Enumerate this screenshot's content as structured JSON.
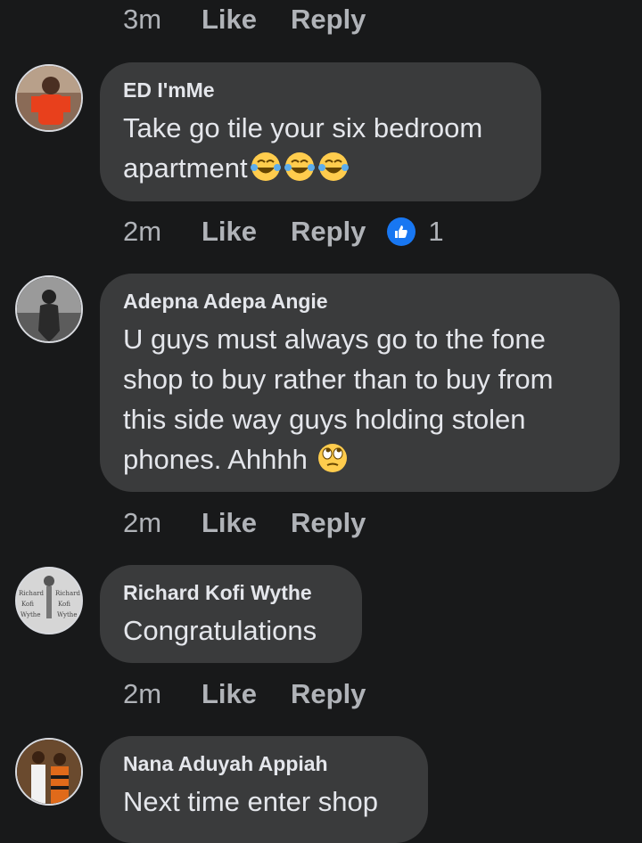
{
  "top_meta": {
    "time": "3m",
    "like": "Like",
    "reply": "Reply"
  },
  "comments": [
    {
      "name": "ED I'mMe",
      "text": "Take go tile your six bedroom apartment",
      "emojis": [
        "joy-emoji",
        "joy-emoji",
        "joy-emoji"
      ],
      "time": "2m",
      "like": "Like",
      "reply": "Reply",
      "reaction_count": "1"
    },
    {
      "name": "Adepna Adepa Angie",
      "text": "U guys must always go to the fone shop to buy rather than to buy from this side way guys holding stolen phones. Ahhhh",
      "emojis": [
        "eye-roll-emoji"
      ],
      "time": "2m",
      "like": "Like",
      "reply": "Reply"
    },
    {
      "name": "Richard Kofi Wythe",
      "text": "Congratulations",
      "time": "2m",
      "like": "Like",
      "reply": "Reply",
      "avatar_text": [
        "Richard",
        "Kofi",
        "Wythe",
        "Richard",
        "Kofi",
        "Wythe"
      ]
    },
    {
      "name": "Nana Aduyah Appiah",
      "text": "Next time enter shop"
    }
  ],
  "colors": {
    "background": "#18191a",
    "bubble": "#3a3b3c",
    "meta": "#b0b3b8",
    "like_blue": "#1877f2"
  }
}
